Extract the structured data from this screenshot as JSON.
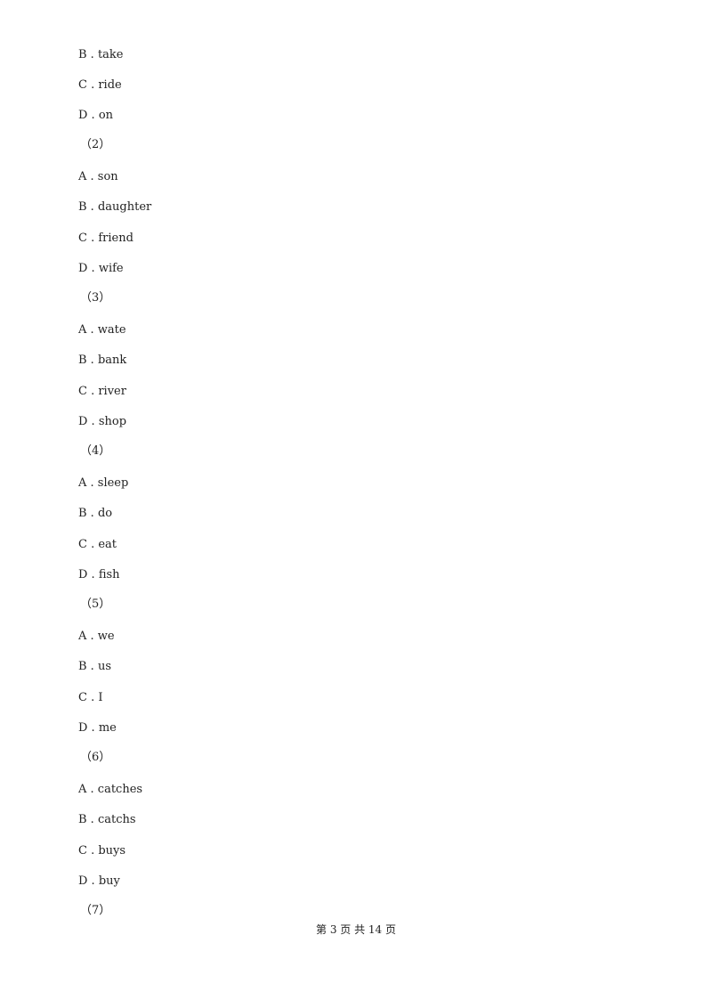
{
  "lines": [
    {
      "type": "option",
      "text": "B . take"
    },
    {
      "type": "option",
      "text": "C . ride"
    },
    {
      "type": "option",
      "text": "D . on"
    },
    {
      "type": "qnum",
      "text": "（2）"
    },
    {
      "type": "option",
      "text": "A . son"
    },
    {
      "type": "option",
      "text": "B . daughter"
    },
    {
      "type": "option",
      "text": "C . friend"
    },
    {
      "type": "option",
      "text": "D . wife"
    },
    {
      "type": "qnum",
      "text": "（3）"
    },
    {
      "type": "option",
      "text": "A . wate"
    },
    {
      "type": "option",
      "text": "B . bank"
    },
    {
      "type": "option",
      "text": "C . river"
    },
    {
      "type": "option",
      "text": "D . shop"
    },
    {
      "type": "qnum",
      "text": "（4）"
    },
    {
      "type": "option",
      "text": "A . sleep"
    },
    {
      "type": "option",
      "text": "B . do"
    },
    {
      "type": "option",
      "text": "C . eat"
    },
    {
      "type": "option",
      "text": "D . fish"
    },
    {
      "type": "qnum",
      "text": "（5）"
    },
    {
      "type": "option",
      "text": "A . we"
    },
    {
      "type": "option",
      "text": "B . us"
    },
    {
      "type": "option",
      "text": "C . I"
    },
    {
      "type": "option",
      "text": "D . me"
    },
    {
      "type": "qnum",
      "text": "（6）"
    },
    {
      "type": "option",
      "text": "A . catches"
    },
    {
      "type": "option",
      "text": "B . catchs"
    },
    {
      "type": "option",
      "text": "C . buys"
    },
    {
      "type": "option",
      "text": "D . buy"
    },
    {
      "type": "qnum",
      "text": "（7）"
    }
  ],
  "footer": {
    "text": "第 3 页 共 14 页"
  }
}
